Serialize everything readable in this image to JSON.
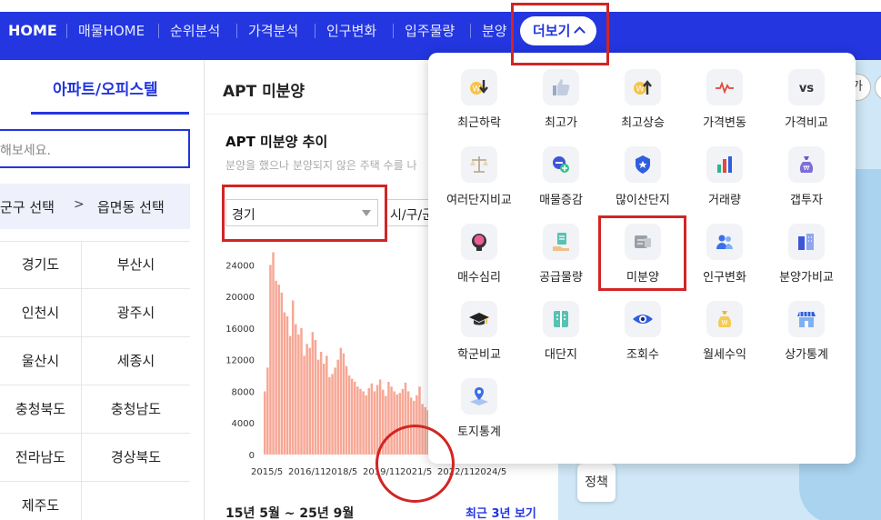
{
  "nav": {
    "home": "HOME",
    "items": [
      "매물HOME",
      "순위분석",
      "가격분석",
      "인구변화",
      "입주물량",
      "분양"
    ],
    "more": "더보기"
  },
  "left": {
    "tab": "아파트/오피스텔",
    "search_placeholder": "해보세요.",
    "region_a": "군구 선택",
    "region_gt": ">",
    "region_b": "읍면동 선택",
    "cities": [
      "경기도",
      "부산시",
      "인천시",
      "광주시",
      "울산시",
      "세종시",
      "충청북도",
      "충청남도",
      "전라남도",
      "경상북도",
      "제주도"
    ]
  },
  "main": {
    "title": "APT 미분양",
    "chart_title": "APT 미분양 추이",
    "chart_desc": "분양을 했으나 분양되지 않은 주택 수를 나",
    "select_value": "경기",
    "select2_value": "시/구/군",
    "range": "15년 5월 ~ 25년 9월",
    "recent": "최근 3년 보기"
  },
  "map": {
    "policy": "정책",
    "corner1": "가",
    "corner2": ""
  },
  "panel": {
    "items": [
      {
        "label": "최근하락",
        "icon": "price-down-icon"
      },
      {
        "label": "최고가",
        "icon": "thumbs-up-icon"
      },
      {
        "label": "최고상승",
        "icon": "price-up-icon"
      },
      {
        "label": "가격변동",
        "icon": "pulse-icon"
      },
      {
        "label": "가격비교",
        "icon": "vs-icon",
        "glyph": "vs"
      },
      {
        "label": "여러단지비교",
        "icon": "scale-icon"
      },
      {
        "label": "매물증감",
        "icon": "plus-minus-icon"
      },
      {
        "label": "많이산단지",
        "icon": "badge-shield-icon"
      },
      {
        "label": "거래량",
        "icon": "bar-chart-icon"
      },
      {
        "label": "갭투자",
        "icon": "money-bag-icon"
      },
      {
        "label": "매수심리",
        "icon": "brain-head-icon"
      },
      {
        "label": "공급물량",
        "icon": "hand-document-icon"
      },
      {
        "label": "미분양",
        "icon": "unsold-sign-icon"
      },
      {
        "label": "인구변화",
        "icon": "people-icon"
      },
      {
        "label": "분양가비교",
        "icon": "buildings-icon"
      },
      {
        "label": "학군비교",
        "icon": "graduation-cap-icon"
      },
      {
        "label": "대단지",
        "icon": "complex-building-icon"
      },
      {
        "label": "조회수",
        "icon": "eye-icon"
      },
      {
        "label": "월세수익",
        "icon": "rent-bag-icon"
      },
      {
        "label": "상가통계",
        "icon": "store-icon"
      },
      {
        "label": "토지통계",
        "icon": "land-pin-icon"
      }
    ]
  },
  "colors": {
    "brand": "#2336e0",
    "bar": "#f7a795",
    "annotation": "#d22525"
  },
  "chart_data": {
    "type": "bar",
    "x_start": "2015/5",
    "x_end": "2025/9",
    "x_tick_labels": [
      "2015/5",
      "2016/11",
      "2018/5",
      "2019/11",
      "2021/5",
      "2022/11",
      "2024/5"
    ],
    "y_tick_labels": [
      "0",
      "4000",
      "8000",
      "12000",
      "16000",
      "20000",
      "24000"
    ],
    "ylim": [
      0,
      26000
    ],
    "values": [
      8000,
      11000,
      24000,
      25600,
      22000,
      21500,
      20500,
      18000,
      17500,
      15000,
      19500,
      16500,
      15200,
      16000,
      12500,
      14000,
      13500,
      15500,
      14500,
      12000,
      13000,
      11500,
      12500,
      9800,
      10200,
      11000,
      12000,
      13500,
      12800,
      11200,
      10000,
      9600,
      9200,
      8600,
      8300,
      8000,
      7500,
      8400,
      9000,
      8000,
      8800,
      9500,
      8200,
      7400,
      9200,
      8600,
      8000,
      7600,
      7800,
      8300,
      9100,
      8000,
      7200,
      6800,
      7500,
      8600,
      6400,
      6000,
      5600,
      5200,
      4800,
      4500,
      4000,
      3600,
      3300,
      3000,
      2500,
      2200,
      2000,
      2400,
      1800,
      1500,
      1300,
      1600,
      1400,
      1200,
      1300,
      1100,
      1000,
      900,
      800,
      1000,
      1200,
      900
    ]
  }
}
